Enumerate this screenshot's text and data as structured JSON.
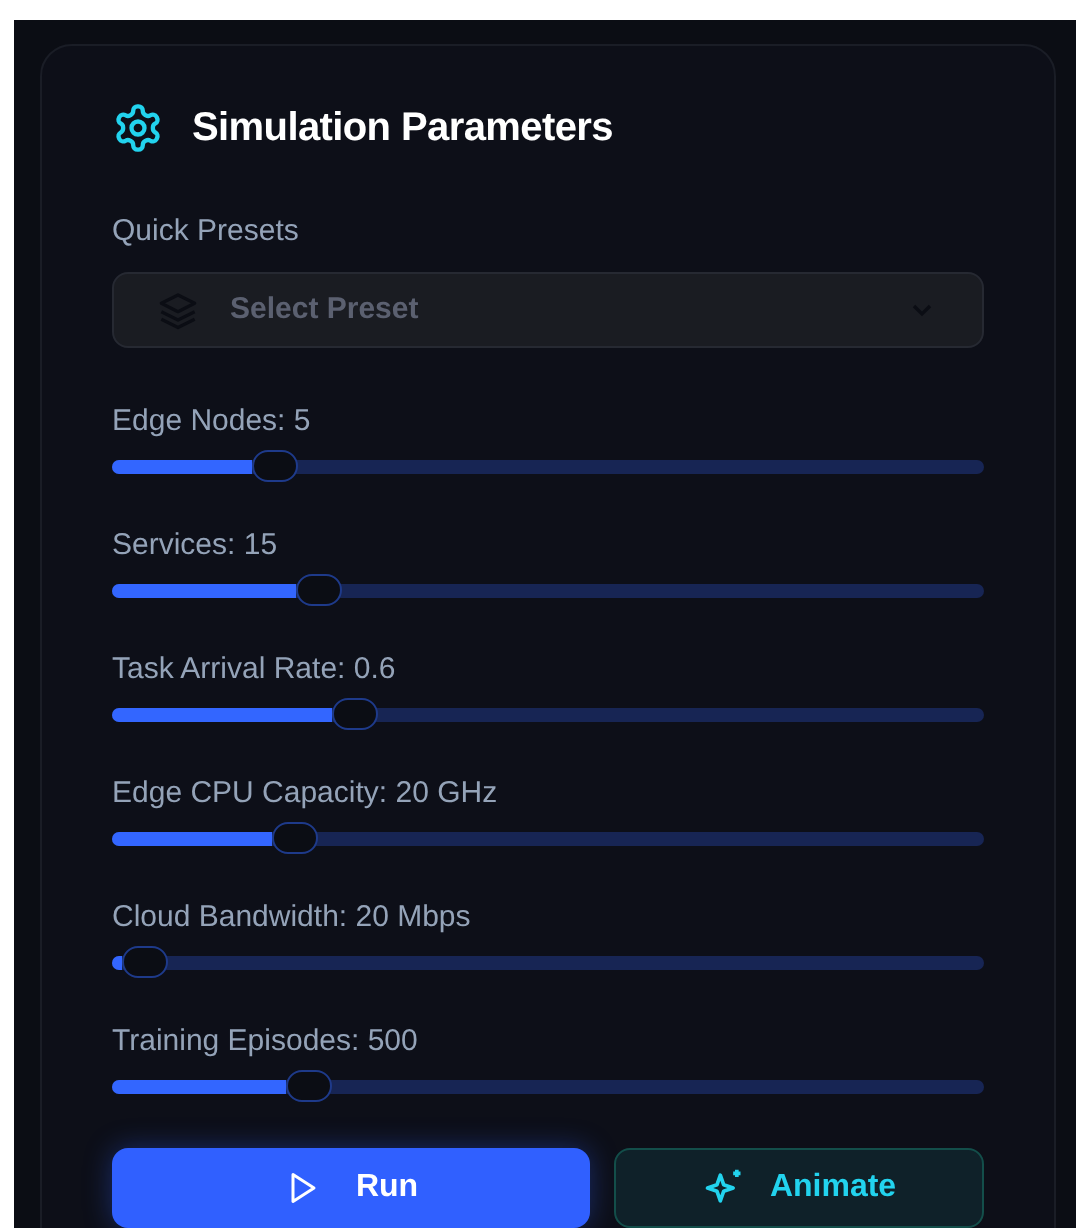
{
  "panel": {
    "title": "Simulation Parameters"
  },
  "presets": {
    "label": "Quick Presets",
    "placeholder": "Select Preset"
  },
  "sliders": [
    {
      "label": "Edge Nodes: 5",
      "level": 0.186
    },
    {
      "label": "Services: 15",
      "level": 0.236
    },
    {
      "label": "Task Arrival Rate: 0.6",
      "level": 0.277
    },
    {
      "label": "Edge CPU Capacity: 20 GHz",
      "level": 0.209
    },
    {
      "label": "Cloud Bandwidth: 20 Mbps",
      "level": 0.037
    },
    {
      "label": "Training Episodes: 500",
      "level": 0.225
    }
  ],
  "buttons": [
    {
      "kind": "primary",
      "label": "Run"
    },
    {
      "kind": "secondary",
      "label": "Animate"
    }
  ]
}
